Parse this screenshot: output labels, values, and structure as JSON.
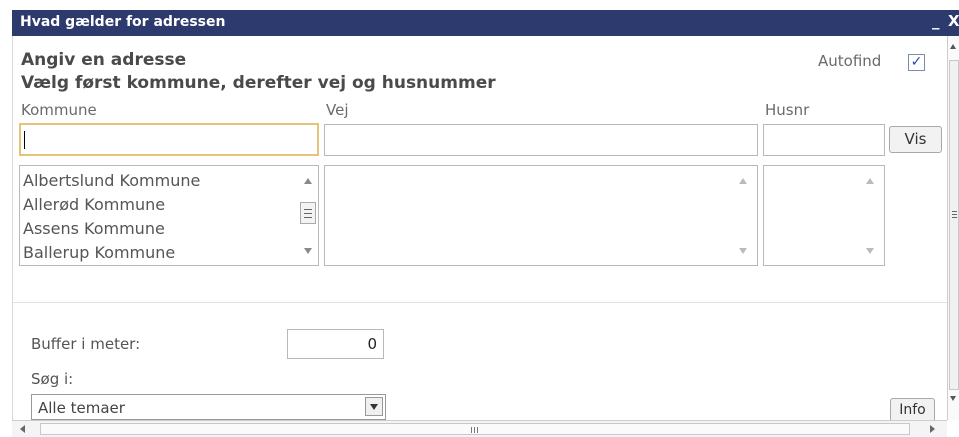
{
  "window": {
    "title": "Hvad gælder for adressen",
    "minimize_glyph": "_",
    "close_glyph": "X"
  },
  "form": {
    "heading1": "Angiv en adresse",
    "heading2": "Vælg først kommune, derefter vej og husnummer",
    "autofind_label": "Autofind",
    "autofind_checked": true,
    "kommune_label": "Kommune",
    "vej_label": "Vej",
    "husnr_label": "Husnr",
    "kommune_value": "",
    "vej_value": "",
    "husnr_value": "",
    "vis_button": "Vis",
    "kommune_list": [
      "Albertslund Kommune",
      "Allerød Kommune",
      "Assens Kommune",
      "Ballerup Kommune"
    ]
  },
  "options": {
    "buffer_label": "Buffer i meter:",
    "buffer_value": "0",
    "search_label": "Søg i:",
    "search_selected": "Alle temaer",
    "info_button": "Info"
  },
  "colors": {
    "titlebar": "#2c3a6e",
    "focus_border": "#e7c37a",
    "checkbox_check": "#2948a0"
  },
  "icons": {
    "minimize": "minimize-icon",
    "close": "close-icon",
    "check": "checkmark-icon",
    "dropdown": "chevron-down-icon"
  }
}
